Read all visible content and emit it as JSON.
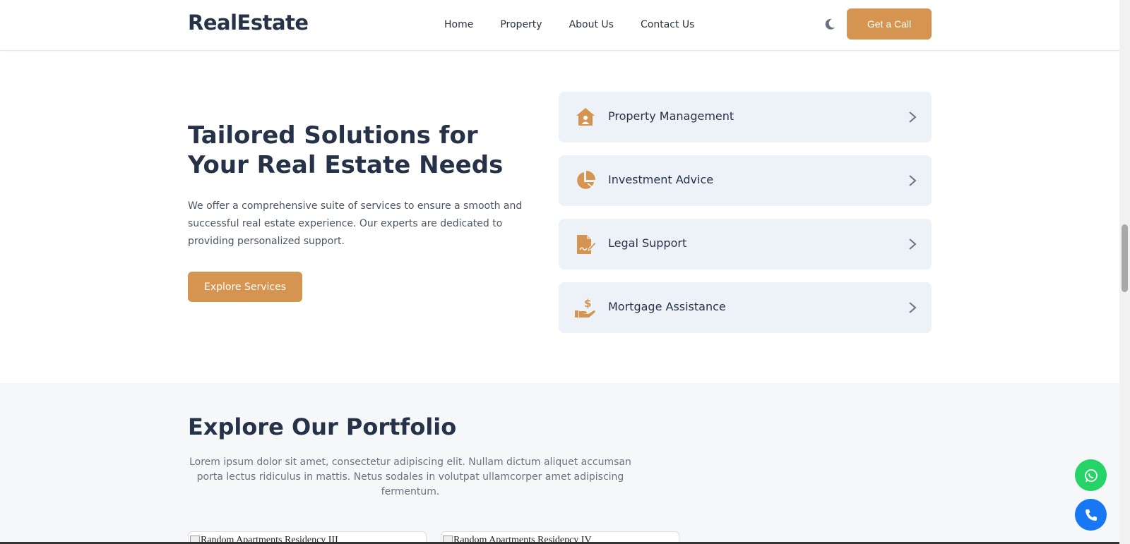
{
  "header": {
    "logo": "RealEstate",
    "nav": [
      "Home",
      "Property",
      "About Us",
      "Contact Us"
    ],
    "cta": "Get a Call"
  },
  "hero": {
    "title": "Tailored Solutions for Your Real Estate Needs",
    "description": "We offer a comprehensive suite of services to ensure a smooth and successful real estate experience. Our experts are dedicated to providing personalized support.",
    "button": "Explore Services"
  },
  "services": [
    {
      "label": "Property Management",
      "icon": "house-user-icon"
    },
    {
      "label": "Investment Advice",
      "icon": "pie-chart-icon"
    },
    {
      "label": "Legal Support",
      "icon": "file-signature-icon"
    },
    {
      "label": "Mortgage Assistance",
      "icon": "hand-dollar-icon"
    }
  ],
  "portfolio": {
    "title": "Explore Our Portfolio",
    "description": "Lorem ipsum dolor sit amet, consectetur adipiscing elit. Nullam dictum aliquet accumsan porta lectus ridiculus in mattis. Netus sodales in volutpat ullamcorper amet adipiscing fermentum.",
    "cards": [
      "Random Apartments Residency III",
      "Random Apartments Residency IV"
    ]
  },
  "colors": {
    "accent": "#d5944f",
    "dark": "#253247",
    "card_bg": "#edf1f8",
    "whatsapp": "#25d366",
    "phone": "#1877f2"
  }
}
